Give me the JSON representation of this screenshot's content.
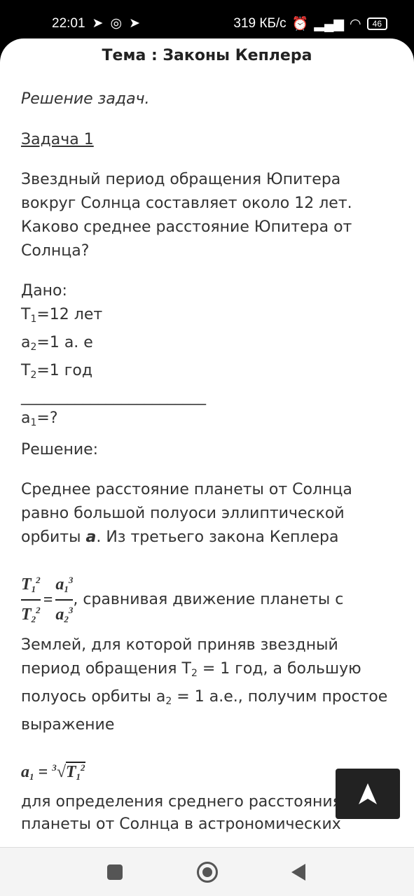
{
  "status": {
    "time": "22:01",
    "speed": "319 КБ/с",
    "battery": "46"
  },
  "title": "Тема : Законы Кеплера",
  "subtitle": "Решение задач.",
  "task": "Задача 1",
  "question": [
    "Звездный период обращения Юпитера",
    "вокруг Солнца составляет около 12 лет.",
    "Каково среднее расстояние Юпитера от",
    "Солнца?"
  ],
  "given": {
    "label": "Дано:",
    "t1": "T",
    "t1s": "1",
    "t1v": "=12 лет",
    "a2": "a",
    "a2s": "2",
    "a2v": "=1 а. е",
    "t2": "T",
    "t2s": "2",
    "t2v": "=1 год",
    "line": "________________________",
    "a1": "a",
    "a1s": "1",
    "a1v": "=?"
  },
  "solution_label": "Решение:",
  "para1": [
    "Среднее расстояние планеты от Солнца",
    "равно большой полуоси эллиптической",
    "орбиты "
  ],
  "para1_a": "a",
  "para1_tail": ". Из третьего закона Кеплера",
  "formula_tail": ", сравнивая движение планеты с",
  "para2": [
    "Землей, для которой приняв звездный",
    "период обращения T",
    "2",
    " = 1 год, а большую",
    "полуось орбиты a",
    "2",
    " = 1 а.е., получим простое",
    "выражение"
  ],
  "para3": [
    "для определения среднего расстояния",
    "планеты от Солнца в астрономических"
  ]
}
